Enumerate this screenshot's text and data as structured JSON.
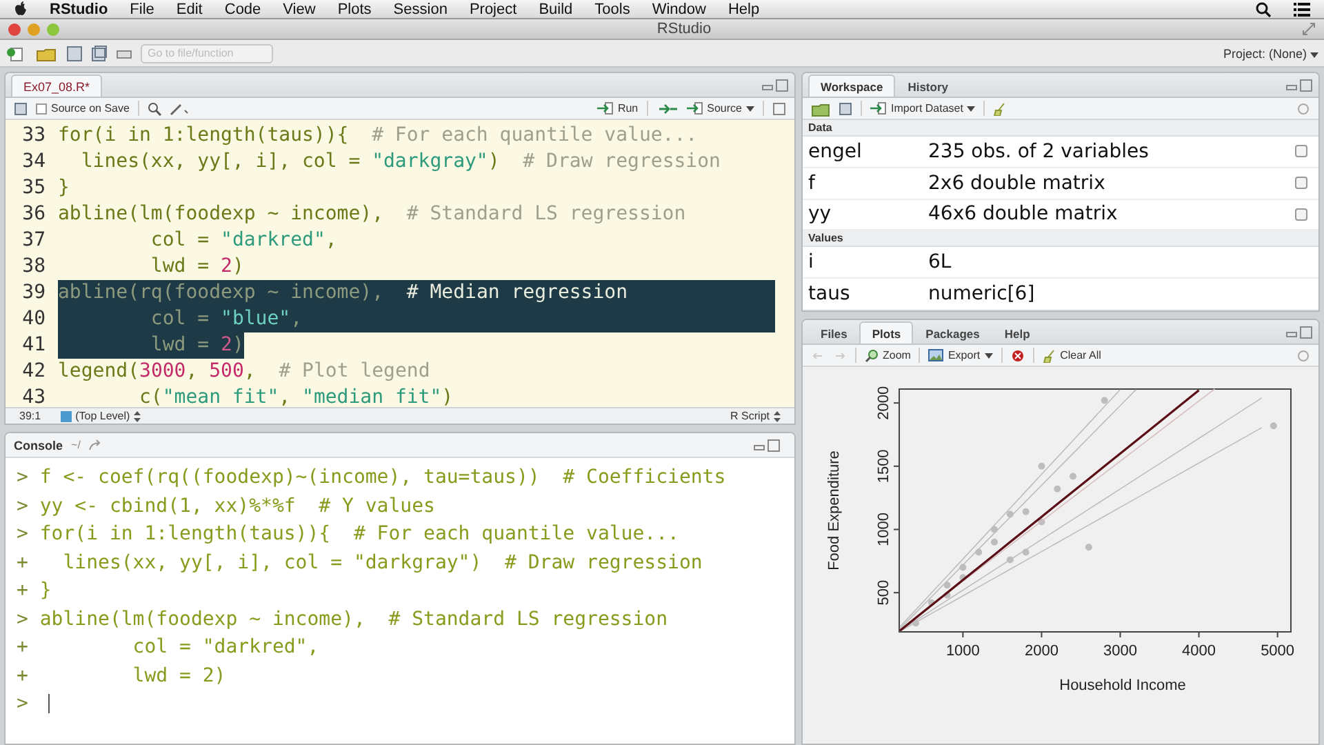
{
  "menubar": {
    "app": "RStudio",
    "items": [
      "File",
      "Edit",
      "Code",
      "View",
      "Plots",
      "Session",
      "Project",
      "Build",
      "Tools",
      "Window",
      "Help"
    ]
  },
  "window": {
    "title": "RStudio"
  },
  "toolbar": {
    "goto_placeholder": "Go to file/function",
    "project": "Project: (None)"
  },
  "editor": {
    "tabs": [
      {
        "label": "Ex07_08.R*",
        "selected": true
      }
    ],
    "source_on_save": {
      "label": "Source on Save",
      "checked": false
    },
    "run": "Run",
    "source": "Source",
    "lines": [
      {
        "number": "33",
        "selected": false,
        "tokens": [
          {
            "kind": "code",
            "text": "for(i in 1:length(taus)){  "
          },
          {
            "kind": "comment",
            "text": "# For each quantile value..."
          }
        ]
      },
      {
        "number": "34",
        "selected": false,
        "tokens": [
          {
            "kind": "code",
            "text": "  lines(xx, yy[, i], col = "
          },
          {
            "kind": "string",
            "text": "\"darkgray\""
          },
          {
            "kind": "code",
            "text": ")  "
          },
          {
            "kind": "comment",
            "text": "# Draw regression"
          }
        ]
      },
      {
        "number": "35",
        "selected": false,
        "tokens": [
          {
            "kind": "code",
            "text": "}"
          }
        ]
      },
      {
        "number": "36",
        "selected": false,
        "tokens": [
          {
            "kind": "code",
            "text": "abline(lm(foodexp ~ income),  "
          },
          {
            "kind": "comment",
            "text": "# Standard LS regression"
          }
        ]
      },
      {
        "number": "37",
        "selected": false,
        "tokens": [
          {
            "kind": "code",
            "text": "        col = "
          },
          {
            "kind": "string",
            "text": "\"darkred\""
          },
          {
            "kind": "code",
            "text": ","
          }
        ]
      },
      {
        "number": "38",
        "selected": false,
        "tokens": [
          {
            "kind": "code",
            "text": "        lwd = "
          },
          {
            "kind": "number",
            "text": "2"
          },
          {
            "kind": "code",
            "text": ")"
          }
        ]
      },
      {
        "number": "39",
        "selected": true,
        "tokens": [
          {
            "kind": "code",
            "text": "abline(rq(foodexp ~ income),  "
          },
          {
            "kind": "comment",
            "text": "# Median regression"
          }
        ]
      },
      {
        "number": "40",
        "selected": true,
        "tokens": [
          {
            "kind": "code",
            "text": "        col = "
          },
          {
            "kind": "string",
            "text": "\"blue\""
          },
          {
            "kind": "code",
            "text": ","
          }
        ]
      },
      {
        "number": "41",
        "selected": true,
        "tokens": [
          {
            "kind": "code",
            "text": "        lwd = "
          },
          {
            "kind": "number",
            "text": "2"
          },
          {
            "kind": "code",
            "text": ")"
          }
        ]
      },
      {
        "number": "42",
        "selected": false,
        "tokens": [
          {
            "kind": "code",
            "text": "legend("
          },
          {
            "kind": "number",
            "text": "3000"
          },
          {
            "kind": "code",
            "text": ", "
          },
          {
            "kind": "number",
            "text": "500"
          },
          {
            "kind": "code",
            "text": ",  "
          },
          {
            "kind": "comment",
            "text": "# Plot legend"
          }
        ]
      },
      {
        "number": "43",
        "selected": false,
        "tokens": [
          {
            "kind": "code",
            "text": "       c("
          },
          {
            "kind": "string",
            "text": "\"mean fit\""
          },
          {
            "kind": "code",
            "text": ", "
          },
          {
            "kind": "string",
            "text": "\"median fit\""
          },
          {
            "kind": "code",
            "text": ")"
          }
        ]
      }
    ],
    "status": {
      "position": "39:1",
      "scope": "(Top Level)",
      "filetype": "R Script"
    }
  },
  "console": {
    "title": "Console",
    "path": "~/",
    "lines": [
      {
        "prompt": ">",
        "text": "f <- coef(rq((foodexp)~(income), tau=taus))  # Coefficients"
      },
      {
        "prompt": ">",
        "text": "yy <- cbind(1, xx)%*%f  # Y values"
      },
      {
        "prompt": ">",
        "text": "for(i in 1:length(taus)){  # For each quantile value..."
      },
      {
        "prompt": "+",
        "text": "  lines(xx, yy[, i], col = \"darkgray\")  # Draw regression"
      },
      {
        "prompt": "+",
        "text": "}"
      },
      {
        "prompt": ">",
        "text": "abline(lm(foodexp ~ income),  # Standard LS regression"
      },
      {
        "prompt": "+",
        "text": "        col = \"darkred\","
      },
      {
        "prompt": "+",
        "text": "        lwd = 2)"
      },
      {
        "prompt": ">"
      }
    ]
  },
  "workspace": {
    "tabs": [
      {
        "label": "Workspace",
        "selected": true
      },
      {
        "label": "History",
        "selected": false
      }
    ],
    "import": "Import Dataset",
    "sections": [
      {
        "title": "Data",
        "rows": [
          {
            "name": "engel",
            "value": "235 obs. of 2 variables",
            "viewable": true
          },
          {
            "name": "f",
            "value": "2x6 double matrix",
            "viewable": true
          },
          {
            "name": "yy",
            "value": "46x6 double matrix",
            "viewable": true
          }
        ]
      },
      {
        "title": "Values",
        "rows": [
          {
            "name": "i",
            "value": "6L",
            "viewable": false
          },
          {
            "name": "taus",
            "value": "numeric[6]",
            "viewable": false
          }
        ]
      }
    ]
  },
  "plots": {
    "tabs": [
      {
        "label": "Files",
        "selected": false
      },
      {
        "label": "Plots",
        "selected": true
      },
      {
        "label": "Packages",
        "selected": false
      },
      {
        "label": "Help",
        "selected": false
      }
    ],
    "zoom": "Zoom",
    "export": "Export",
    "clear": "Clear All",
    "chart_data": {
      "type": "scatter",
      "xlabel": "Household Income",
      "ylabel": "Food Expenditure",
      "xlim": [
        190,
        5170
      ],
      "ylim": [
        190,
        2110
      ],
      "xticks": [
        1000,
        2000,
        3000,
        4000,
        5000
      ],
      "yticks": [
        500,
        1000,
        1500,
        2000
      ],
      "x": [
        200,
        400,
        600,
        800,
        1000,
        1200,
        1400,
        1600,
        1800,
        2000,
        2200,
        2400,
        2600,
        2800,
        3000,
        3200,
        3600,
        4000,
        4200,
        4800,
        4950
      ],
      "series": [
        {
          "color": "#bdbdbd",
          "values": [
            null,
            null,
            420,
            560,
            700,
            820,
            900,
            1120,
            1140,
            1500,
            1320,
            1420,
            860,
            2020,
            null,
            null,
            null,
            null,
            null,
            null,
            1820
          ]
        },
        {
          "color": "#bdbdbd",
          "values": [
            null,
            260,
            null,
            480,
            620,
            null,
            1000,
            760,
            820,
            1060,
            null,
            null,
            null,
            null,
            null,
            null,
            null,
            null,
            null,
            null,
            null
          ]
        },
        {
          "type": "line",
          "color": "#bdbdbd",
          "values": [
            230,
            364,
            498,
            632,
            766,
            900,
            1034,
            1168,
            1302,
            1436,
            1570,
            1704,
            1838,
            1972,
            2106,
            null,
            null,
            null,
            null,
            null,
            null
          ]
        },
        {
          "type": "line",
          "color": "#bdbdbd",
          "values": [
            215,
            341,
            467,
            593,
            719,
            845,
            971,
            1097,
            1223,
            1349,
            1475,
            1601,
            1727,
            1853,
            1979,
            2105,
            null,
            null,
            null,
            null,
            null
          ]
        },
        {
          "type": "line",
          "color": "#d8c0c0",
          "values": [
            210,
            305,
            400,
            495,
            590,
            685,
            780,
            875,
            970,
            1065,
            1160,
            1255,
            1350,
            1445,
            1540,
            1635,
            1825,
            2015,
            2110,
            null,
            null
          ]
        },
        {
          "type": "line",
          "color": "#bdbdbd",
          "values": [
            200,
            280,
            360,
            440,
            520,
            600,
            680,
            760,
            840,
            920,
            1000,
            1080,
            1160,
            1240,
            1320,
            1400,
            1560,
            1720,
            1800,
            2040,
            null
          ]
        },
        {
          "type": "line",
          "color": "#bdbdbd",
          "values": [
            195,
            265,
            335,
            405,
            475,
            545,
            615,
            685,
            755,
            825,
            895,
            965,
            1035,
            1105,
            1175,
            1245,
            1385,
            1525,
            1595,
            1805,
            null
          ]
        },
        {
          "type": "line",
          "color": "#5a0e16",
          "values": [
            200,
            300,
            400,
            500,
            600,
            700,
            800,
            900,
            1000,
            1100,
            1200,
            1300,
            1400,
            1500,
            1600,
            1700,
            1900,
            2100,
            null,
            null,
            null
          ]
        }
      ]
    }
  }
}
